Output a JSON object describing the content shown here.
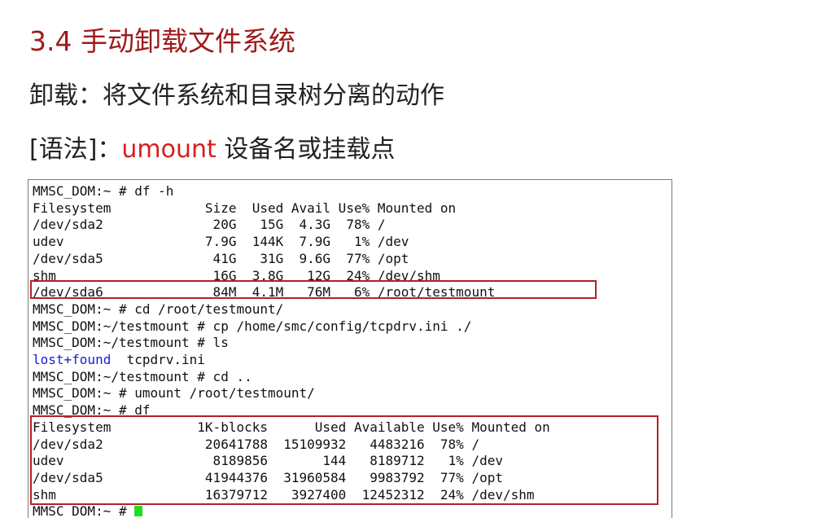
{
  "slide": {
    "title": "3.4 手动卸载文件系统",
    "definition": "卸载：将文件系统和目录树分离的动作",
    "syntax_prefix": "[语法]：",
    "syntax_command": "umount",
    "syntax_args": "设备名或挂载点"
  },
  "terminal": {
    "lines": [
      "MMSC_DOM:~ # df -h",
      "Filesystem            Size  Used Avail Use% Mounted on",
      "/dev/sda2              20G   15G  4.3G  78% /",
      "udev                  7.9G  144K  7.9G   1% /dev",
      "/dev/sda5              41G   31G  9.6G  77% /opt",
      "shm                    16G  3.8G   12G  24% /dev/shm",
      "/dev/sda6              84M  4.1M   76M   6% /root/testmount",
      "MMSC_DOM:~ # cd /root/testmount/",
      "MMSC_DOM:~/testmount # cp /home/smc/config/tcpdrv.ini ./",
      "MMSC_DOM:~/testmount # ls",
      "",
      "MMSC_DOM:~/testmount # cd ..",
      "MMSC_DOM:~ # umount /root/testmount/",
      "MMSC_DOM:~ # df",
      "Filesystem           1K-blocks      Used Available Use% Mounted on",
      "/dev/sda2             20641788  15109932   4483216  78% /",
      "udev                   8189856       144   8189712   1% /dev",
      "/dev/sda5             41944376  31960584   9983792  77% /opt",
      "shm                   16379712   3927400  12452312  24% /dev/shm",
      "MMSC_DOM:~ # "
    ],
    "ls_dir": "lost+found",
    "ls_file": "tcpdrv.ini",
    "cursor_color": "#22dd22"
  },
  "colors": {
    "title": "#9e1b1b",
    "command": "#d41f1f",
    "highlight_box": "#b32025",
    "directory": "#1a1ad6"
  }
}
